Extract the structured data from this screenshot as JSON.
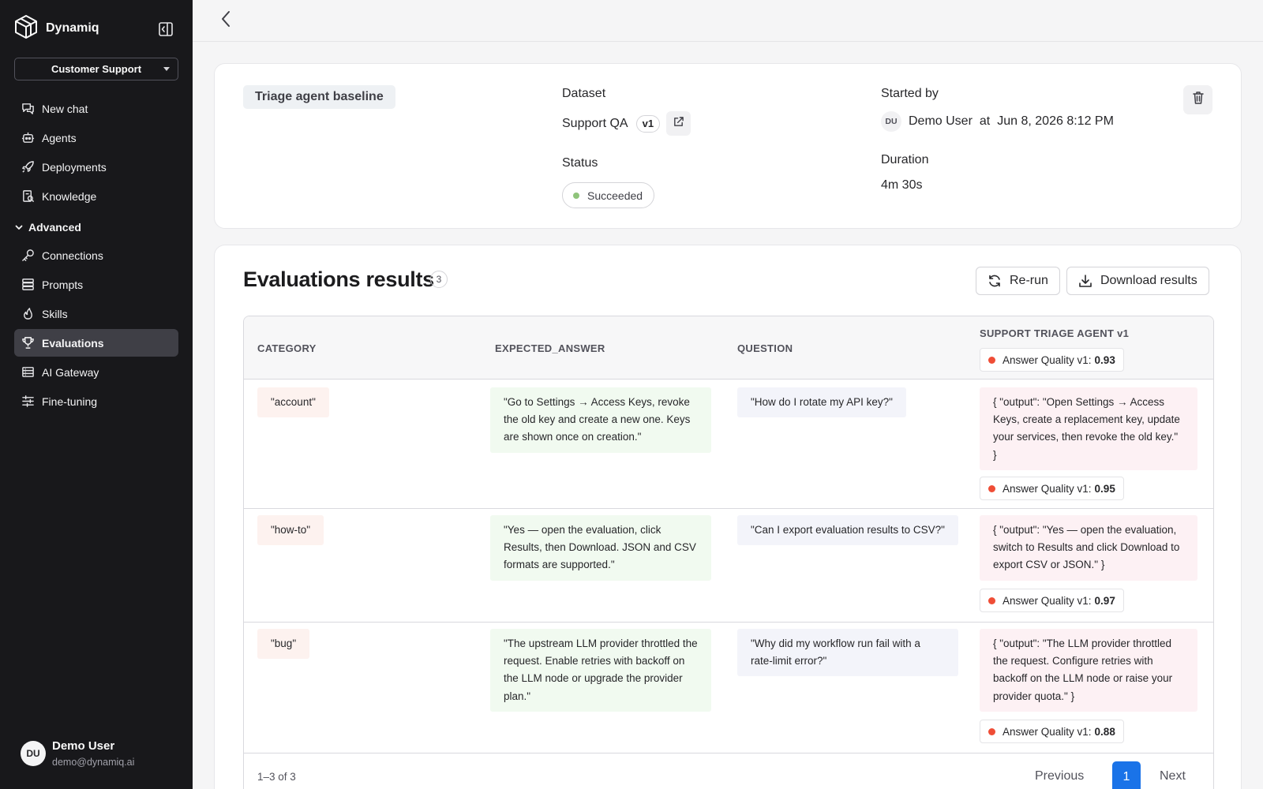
{
  "sidebar": {
    "brand": "Dynamiq",
    "org": "Customer Support",
    "items": [
      {
        "label": "New chat",
        "icon": "chat-icon"
      },
      {
        "label": "Agents",
        "icon": "agent-icon"
      },
      {
        "label": "Deployments",
        "icon": "rocket-icon"
      },
      {
        "label": "Knowledge",
        "icon": "knowledge-icon"
      }
    ],
    "section": "Advanced",
    "advanced_items": [
      {
        "label": "Connections",
        "icon": "key-icon"
      },
      {
        "label": "Prompts",
        "icon": "prompts-icon"
      },
      {
        "label": "Skills",
        "icon": "skills-icon"
      },
      {
        "label": "Evaluations",
        "icon": "trophy-icon",
        "active": true
      },
      {
        "label": "AI Gateway",
        "icon": "gateway-icon"
      },
      {
        "label": "Fine-tuning",
        "icon": "sliders-icon"
      }
    ],
    "user": {
      "initials": "DU",
      "name": "Demo User",
      "email": "demo@dynamiq.ai"
    }
  },
  "summary": {
    "title": "Triage agent baseline",
    "dataset_label": "Dataset",
    "dataset_name": "Support QA",
    "dataset_version": "v1",
    "status_label": "Status",
    "status": "Succeeded",
    "started_by_label": "Started by",
    "started_by_initials": "DU",
    "started_by_name": "Demo User",
    "at_label": "at",
    "started_at": "Jun 8, 2026 8:12 PM",
    "duration_label": "Duration",
    "duration": "4m 30s"
  },
  "evaluations": {
    "title": "Evaluations results",
    "count": "3",
    "rerun_label": "Re-run",
    "download_label": "Download results",
    "columns": [
      "CATEGORY",
      "EXPECTED_ANSWER",
      "QUESTION",
      "SUPPORT TRIAGE AGENT v1"
    ],
    "header_metric": {
      "label": "Answer Quality v1:",
      "value": "0.93"
    },
    "rows": [
      {
        "category": "\"account\"",
        "expected_answer": "\"Go to Settings → Access Keys, revoke the old key and create a new one. Keys are shown once on creation.\"",
        "question": "\"How do I rotate my API key?\"",
        "output": "{ \"output\": \"Open Settings → Access Keys, create a replacement key, update your services, then revoke the old key.\" }",
        "metric_label": "Answer Quality v1:",
        "metric_value": "0.95"
      },
      {
        "category": "\"how-to\"",
        "expected_answer": "\"Yes — open the evaluation, click Results, then Download. JSON and CSV formats are supported.\"",
        "question": "\"Can I export evaluation results to CSV?\"",
        "output": "{ \"output\": \"Yes — open the evaluation, switch to Results and click Download to export CSV or JSON.\" }",
        "metric_label": "Answer Quality v1:",
        "metric_value": "0.97"
      },
      {
        "category": "\"bug\"",
        "expected_answer": "\"The upstream LLM provider throttled the request. Enable retries with backoff on the LLM node or upgrade the provider plan.\"",
        "question": "\"Why did my workflow run fail with a rate-limit error?\"",
        "output": "{ \"output\": \"The LLM provider throttled the request. Configure retries with backoff on the LLM node or raise your provider quota.\" }",
        "metric_label": "Answer Quality v1:",
        "metric_value": "0.88"
      }
    ],
    "range": "1–3 of 3",
    "prev_label": "Previous",
    "current_page": "1",
    "next_label": "Next"
  },
  "colors": {
    "sidebar_bg": "#18181b",
    "active_item_bg": "#3f3f46",
    "status_success": "#8fc47b",
    "metric_dot": "#ef4d36",
    "primary": "#1a73e8"
  }
}
